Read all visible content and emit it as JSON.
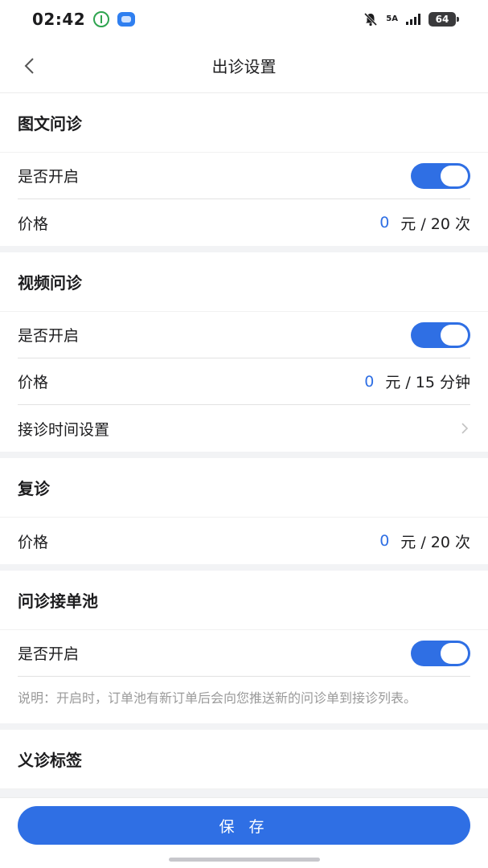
{
  "status_bar": {
    "time": "02:42",
    "network": "5A",
    "battery": "64"
  },
  "nav": {
    "title": "出诊设置",
    "back_icon": "chevron-left-icon"
  },
  "sections": {
    "image_text": {
      "title": "图文问诊",
      "enable_label": "是否开启",
      "enabled": true,
      "price_label": "价格",
      "price_value": "0",
      "price_unit": "元 / 20 次"
    },
    "video": {
      "title": "视频问诊",
      "enable_label": "是否开启",
      "enabled": true,
      "price_label": "价格",
      "price_value": "0",
      "price_unit": "元 / 15 分钟",
      "schedule_label": "接诊时间设置"
    },
    "follow_up": {
      "title": "复诊",
      "price_label": "价格",
      "price_value": "0",
      "price_unit": "元 / 20 次"
    },
    "order_pool": {
      "title": "问诊接单池",
      "enable_label": "是否开启",
      "enabled": true,
      "note": "说明：开启时，订单池有新订单后会向您推送新的问诊单到接诊列表。"
    },
    "free_clinic": {
      "title": "义诊标签"
    }
  },
  "footer": {
    "save_label": "保 存"
  },
  "colors": {
    "accent": "#2f6fe4",
    "background": "#f2f3f5"
  }
}
